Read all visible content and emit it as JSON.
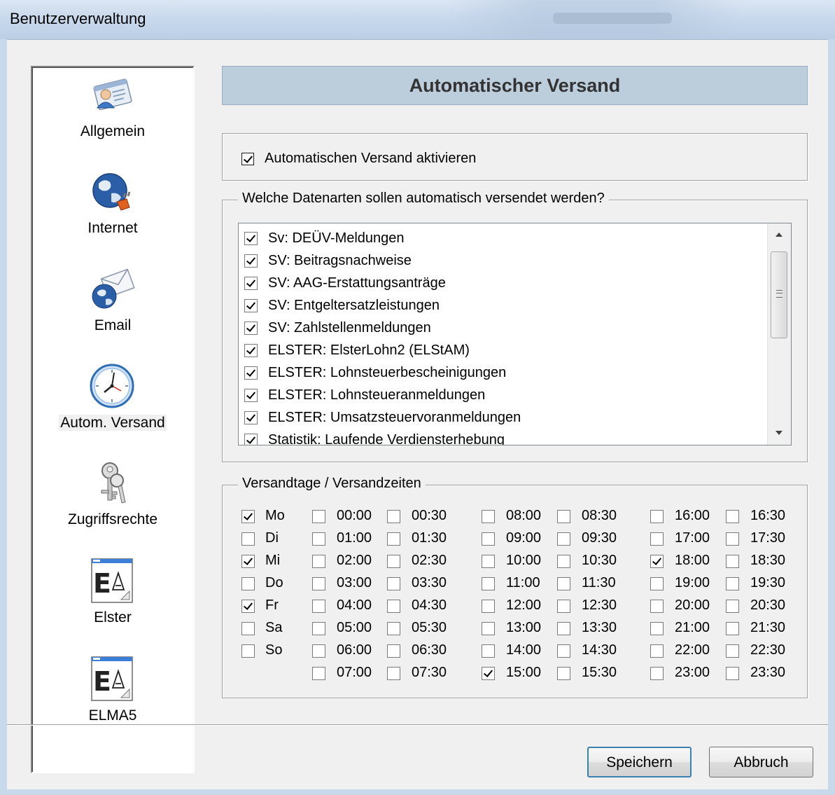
{
  "window": {
    "title": "Benutzerverwaltung"
  },
  "sidebar": {
    "items": [
      {
        "label": "Allgemein",
        "icon": "user-card-icon"
      },
      {
        "label": "Internet",
        "icon": "globe-plug-icon"
      },
      {
        "label": "Email",
        "icon": "globe-mail-icon"
      },
      {
        "label": "Autom. Versand",
        "icon": "clock-icon",
        "selected": true
      },
      {
        "label": "Zugriffsrechte",
        "icon": "keys-icon"
      },
      {
        "label": "Elster",
        "icon": "elster-document-icon"
      },
      {
        "label": "ELMA5",
        "icon": "elma5-document-icon"
      }
    ]
  },
  "header": {
    "title": "Automatischer Versand"
  },
  "activate": {
    "label": "Automatischen Versand aktivieren",
    "checked": true
  },
  "datatypes": {
    "legend": "Welche Datenarten sollen automatisch versendet werden?",
    "items": [
      {
        "label": "Sv: DEÜV-Meldungen",
        "checked": true
      },
      {
        "label": "SV: Beitragsnachweise",
        "checked": true
      },
      {
        "label": "SV: AAG-Erstattungsanträge",
        "checked": true
      },
      {
        "label": "SV: Entgeltersatzleistungen",
        "checked": true
      },
      {
        "label": "SV: Zahlstellenmeldungen",
        "checked": true
      },
      {
        "label": "ELSTER: ElsterLohn2 (ELStAM)",
        "checked": true
      },
      {
        "label": "ELSTER: Lohnsteuerbescheinigungen",
        "checked": true
      },
      {
        "label": "ELSTER: Lohnsteueranmeldungen",
        "checked": true
      },
      {
        "label": "ELSTER: Umsatzsteuervoranmeldungen",
        "checked": true
      },
      {
        "label": "Statistik: Laufende Verdiensterhebung",
        "checked": true
      }
    ]
  },
  "schedule": {
    "legend": "Versandtage / Versandzeiten",
    "days": [
      {
        "label": "Mo",
        "checked": true
      },
      {
        "label": "Di",
        "checked": false
      },
      {
        "label": "Mi",
        "checked": true
      },
      {
        "label": "Do",
        "checked": false
      },
      {
        "label": "Fr",
        "checked": true
      },
      {
        "label": "Sa",
        "checked": false
      },
      {
        "label": "So",
        "checked": false
      }
    ],
    "times": [
      [
        "00:00",
        "00:30",
        "08:00",
        "08:30",
        "16:00",
        "16:30"
      ],
      [
        "01:00",
        "01:30",
        "09:00",
        "09:30",
        "17:00",
        "17:30"
      ],
      [
        "02:00",
        "02:30",
        "10:00",
        "10:30",
        "18:00",
        "18:30"
      ],
      [
        "03:00",
        "03:30",
        "11:00",
        "11:30",
        "19:00",
        "19:30"
      ],
      [
        "04:00",
        "04:30",
        "12:00",
        "12:30",
        "20:00",
        "20:30"
      ],
      [
        "05:00",
        "05:30",
        "13:00",
        "13:30",
        "21:00",
        "21:30"
      ],
      [
        "06:00",
        "06:30",
        "14:00",
        "14:30",
        "22:00",
        "22:30"
      ],
      [
        "07:00",
        "07:30",
        "15:00",
        "15:30",
        "23:00",
        "23:30"
      ]
    ],
    "checked_times": [
      "15:00",
      "18:00"
    ]
  },
  "buttons": {
    "save": "Speichern",
    "cancel": "Abbruch"
  }
}
